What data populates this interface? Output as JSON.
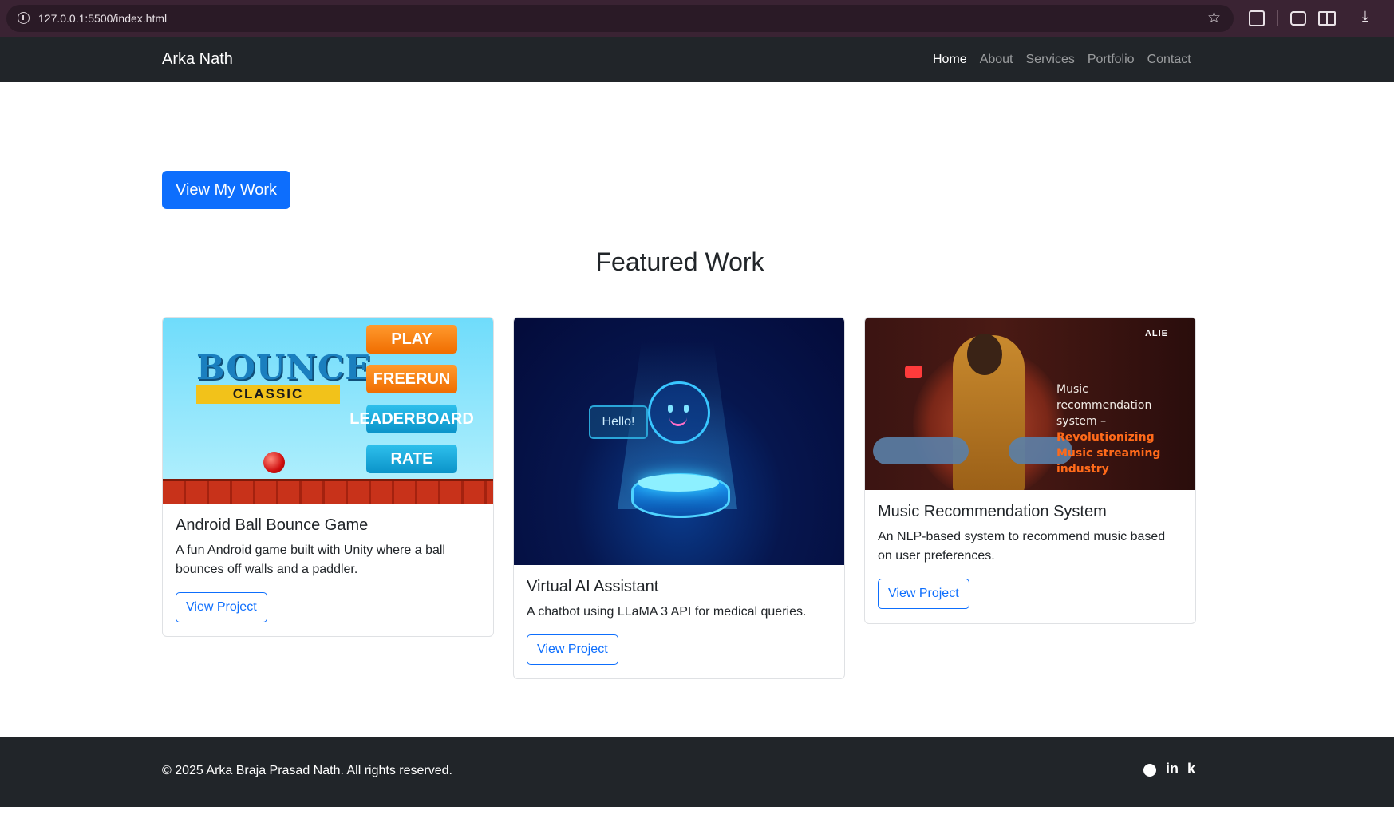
{
  "browser": {
    "url": "127.0.0.1:5500/index.html",
    "icons": [
      "info-icon",
      "star-icon",
      "extensions-icon",
      "screenshot-icon",
      "reader-icon",
      "download-icon"
    ]
  },
  "navbar": {
    "brand": "Arka Nath",
    "links": [
      "Home",
      "About",
      "Services",
      "Portfolio",
      "Contact"
    ],
    "active": "Home"
  },
  "hero": {
    "cta_label": "View My Work"
  },
  "featured": {
    "title": "Featured Work",
    "projects": [
      {
        "title": "Android Ball Bounce Game",
        "description": "A fun Android game built with Unity where a ball bounces off walls and a paddler.",
        "button": "View Project",
        "image": {
          "logo": "BOUNCE",
          "subtitle": "CLASSIC",
          "buttons": [
            "PLAY",
            "FREERUN",
            "LEADERBOARD",
            "RATE"
          ]
        }
      },
      {
        "title": "Virtual AI Assistant",
        "description": "A chatbot using LLaMA 3 API for medical queries.",
        "button": "View Project",
        "image": {
          "bubble": "Hello!"
        }
      },
      {
        "title": "Music Recommendation System",
        "description": "An NLP-based system to recommend music based on user preferences.",
        "button": "View Project",
        "image": {
          "logo": "ALIE",
          "caption_plain": "Music recommendation system – ",
          "caption_highlight": "Revolutionizing Music streaming industry"
        }
      }
    ]
  },
  "footer": {
    "copyright": "© 2025 Arka Braja Prasad Nath. All rights reserved.",
    "social": [
      "github-icon",
      "linkedin-icon",
      "kaggle-icon"
    ],
    "linkedin_glyph": "in",
    "kaggle_glyph": "k"
  },
  "colors": {
    "primary": "#0d6efd",
    "navbar_bg": "#212529",
    "footer_bg": "#212529",
    "browser_bg": "#3a2333"
  }
}
